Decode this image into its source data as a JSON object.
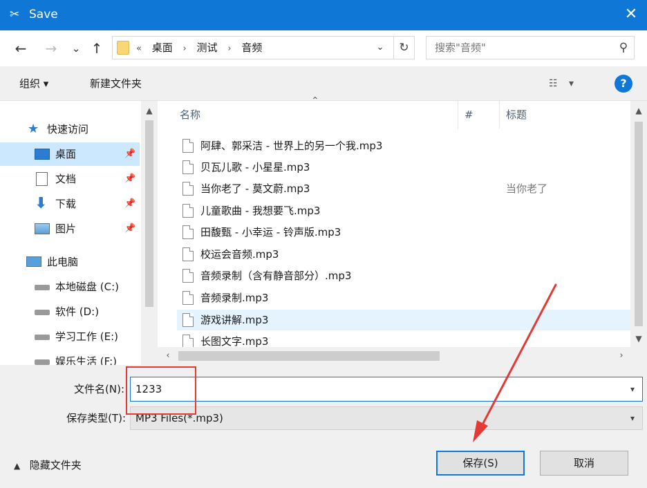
{
  "window": {
    "title": "Save",
    "close_glyph": "✕",
    "app_icon": "scissors-icon"
  },
  "nav": {
    "back": "←",
    "forward": "→",
    "recent": "⌄",
    "up": "↑",
    "address": {
      "overflow": "«",
      "crumbs": [
        "桌面",
        "测试",
        "音频"
      ]
    },
    "search_placeholder": "搜索\"音频\""
  },
  "toolbar": {
    "organize": "组织 ▾",
    "new_folder": "新建文件夹",
    "view": "☷ ▾",
    "help": "?"
  },
  "sidebar": {
    "items": [
      {
        "label": "快速访问",
        "icon": "star-icon"
      },
      {
        "label": "桌面",
        "icon": "desktop-icon",
        "selected": true,
        "pinned": true
      },
      {
        "label": "文档",
        "icon": "document-icon",
        "pinned": true
      },
      {
        "label": "下载",
        "icon": "download-icon",
        "pinned": true
      },
      {
        "label": "图片",
        "icon": "pictures-icon",
        "pinned": true
      },
      {
        "label": "此电脑",
        "icon": "computer-icon"
      },
      {
        "label": "本地磁盘 (C:)",
        "icon": "drive-icon"
      },
      {
        "label": "软件 (D:)",
        "icon": "drive-icon"
      },
      {
        "label": "学习工作 (E:)",
        "icon": "drive-icon"
      },
      {
        "label": "娱乐生活 (F:)",
        "icon": "drive-icon"
      }
    ]
  },
  "columns": {
    "name": "名称",
    "number": "#",
    "title": "标题"
  },
  "files": [
    {
      "name": "阿肆、郭采洁 - 世界上的另一个我.mp3",
      "title": ""
    },
    {
      "name": "贝瓦儿歌 - 小星星.mp3",
      "title": ""
    },
    {
      "name": "当你老了 - 莫文蔚.mp3",
      "title": "当你老了"
    },
    {
      "name": "儿童歌曲 - 我想要飞.mp3",
      "title": ""
    },
    {
      "name": "田馥甄 - 小幸运 - 铃声版.mp3",
      "title": ""
    },
    {
      "name": "校运会音频.mp3",
      "title": ""
    },
    {
      "name": "音频录制（含有静音部分）.mp3",
      "title": ""
    },
    {
      "name": "音频录制.mp3",
      "title": ""
    },
    {
      "name": "游戏讲解.mp3",
      "title": "",
      "hover": true
    },
    {
      "name": "长图文字.mp3",
      "title": ""
    }
  ],
  "form": {
    "filename_label": "文件名(N):",
    "filename_value": "1233",
    "filetype_label": "保存类型(T):",
    "filetype_value": "MP3 Files(*.mp3)"
  },
  "footer": {
    "hide_folders": "隐藏文件夹",
    "save": "保存(S)",
    "cancel": "取消"
  },
  "colors": {
    "accent": "#0f78d7",
    "annotation": "#e53935",
    "selection": "#cce8ff"
  }
}
